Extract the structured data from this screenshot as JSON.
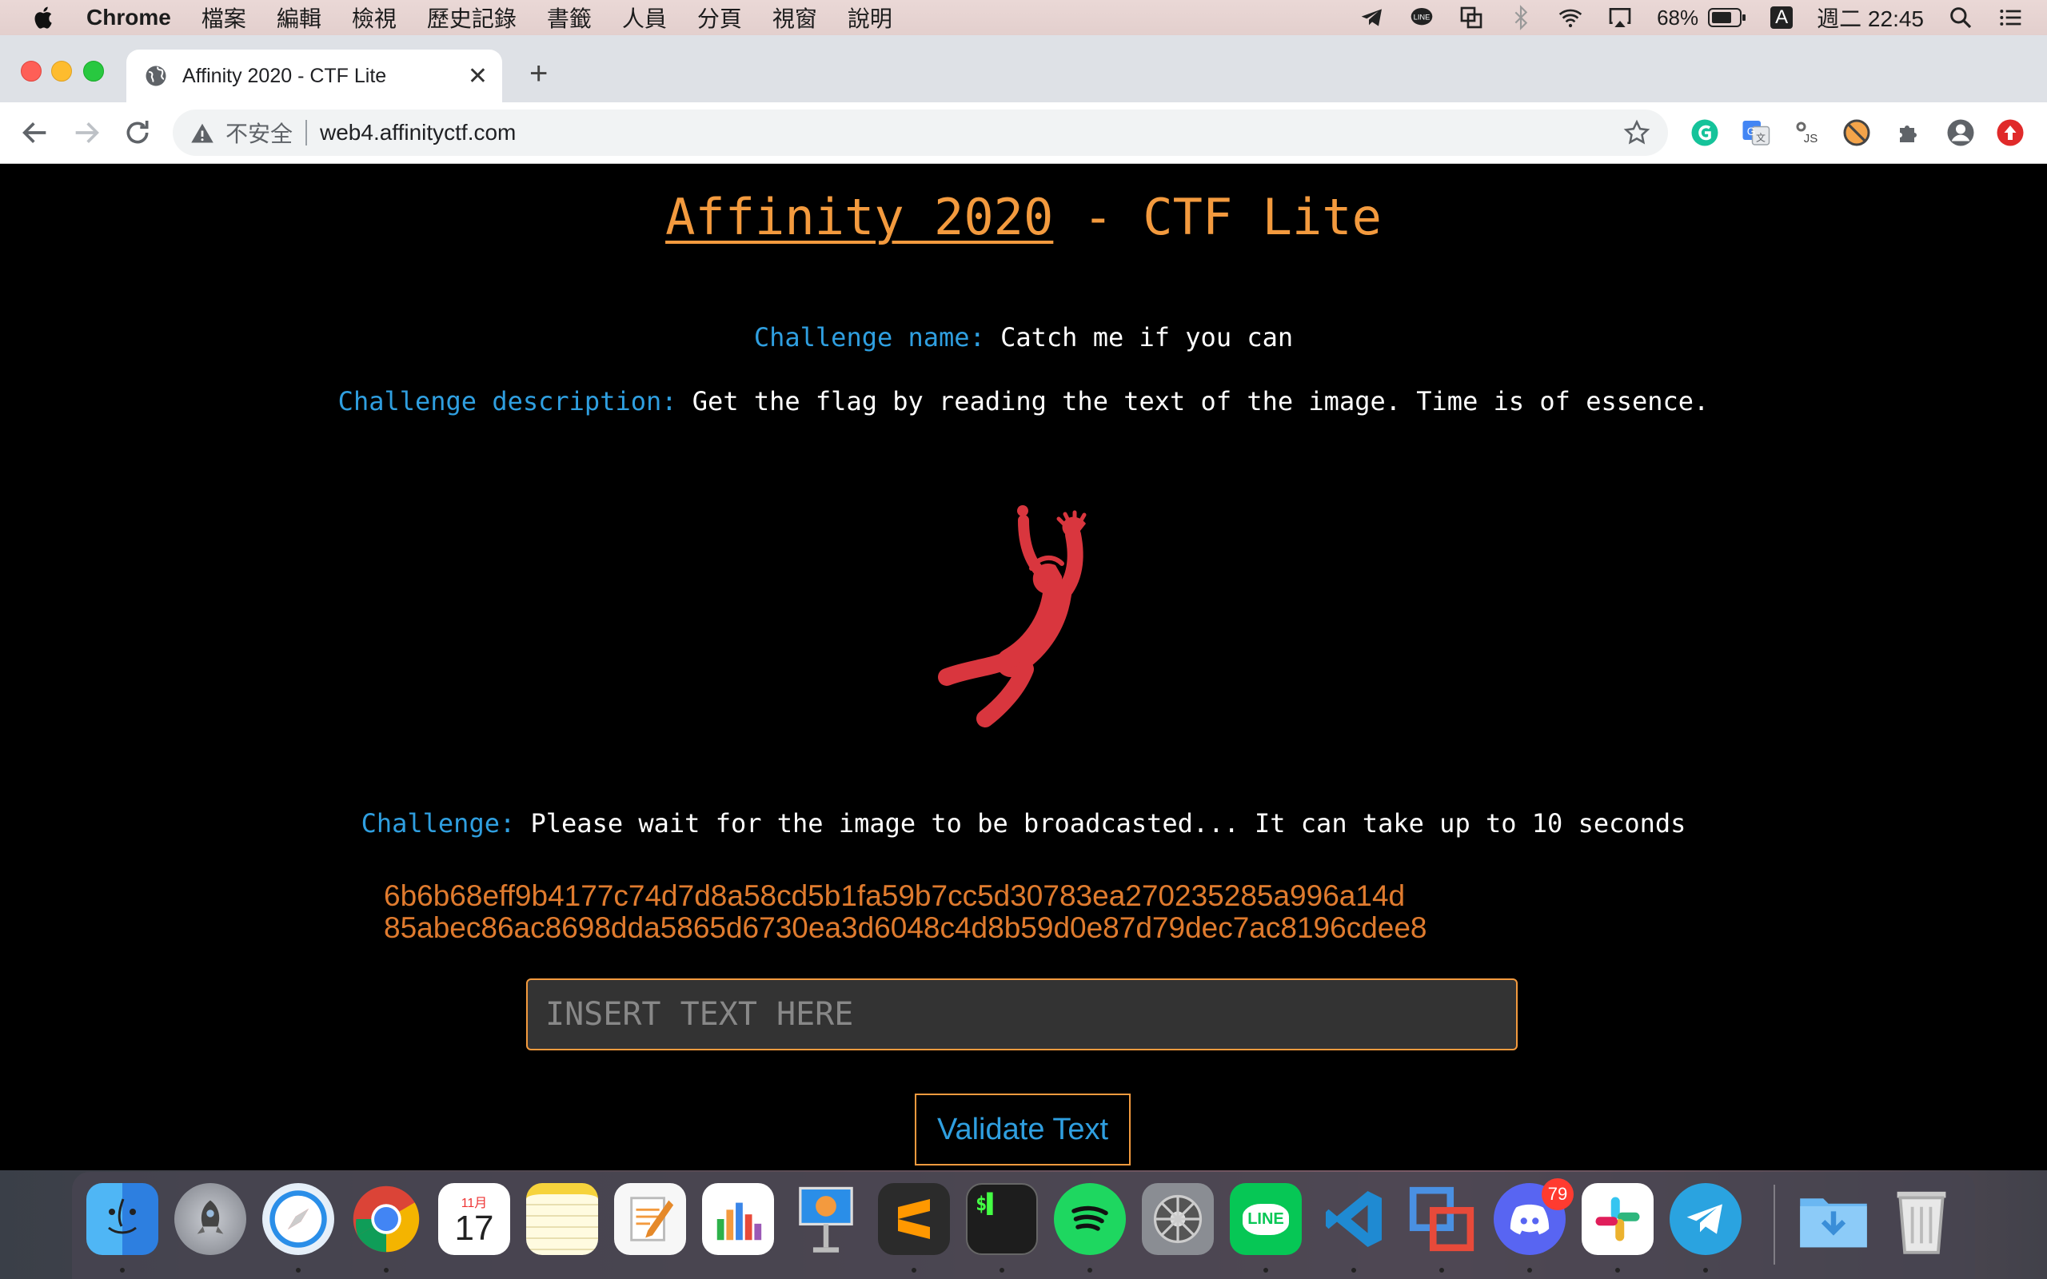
{
  "menubar": {
    "app_name": "Chrome",
    "items": [
      "檔案",
      "編輯",
      "檢視",
      "歷史記錄",
      "書籤",
      "人員",
      "分頁",
      "視窗",
      "說明"
    ],
    "battery": "68%",
    "input_source": "A",
    "clock": "週二 22:45"
  },
  "browser": {
    "tab_title": "Affinity 2020 - CTF Lite",
    "tab_close": "✕",
    "new_tab": "+",
    "security_label": "不安全",
    "url": "web4.affinityctf.com"
  },
  "page": {
    "title_link": "Affinity 2020",
    "title_rest": " - CTF Lite",
    "challenge_name_label": "Challenge name:",
    "challenge_name": "Catch me if you can",
    "description_label": "Challenge description:",
    "description": "Get the flag by reading the text of the image. Time is of essence.",
    "challenge_label": "Challenge:",
    "challenge_text": "Please wait for the image to be broadcasted... It can take up to 10 seconds",
    "hash_line1": "6b6b68eff9b4177c74d7d8a58cd5b1fa59b7cc5d30783ea270235285a996a14d",
    "hash_line2": "85abec86ac8698dda5865d6730ea3d6048c4d8b59d0e87d79dec7ac8196cdee8",
    "input_placeholder": "INSERT TEXT HERE",
    "validate_button": "Validate Text"
  },
  "dock": {
    "calendar_month": "11月",
    "calendar_day": "17",
    "discord_badge": "79",
    "line_label": "LINE"
  },
  "colors": {
    "accent_orange": "#f39a3e",
    "label_blue": "#2f9fe0",
    "hash_orange": "#e07b2e",
    "figure_red": "#d9363e"
  }
}
